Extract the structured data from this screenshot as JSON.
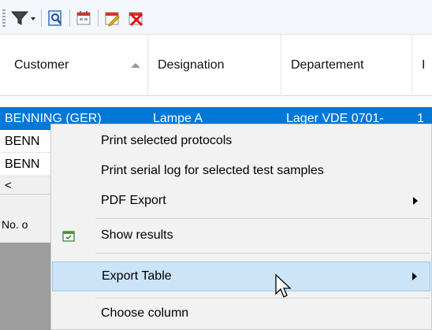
{
  "toolbar": {
    "buttons": [
      {
        "icon": "filter-dropdown-icon"
      },
      {
        "icon": "search-document-icon"
      },
      {
        "icon": "calendar-icon"
      },
      {
        "icon": "edit-calendar-icon"
      },
      {
        "icon": "delete-calendar-icon"
      }
    ]
  },
  "grid": {
    "columns": [
      {
        "label": "Customer",
        "sort": "ascending"
      },
      {
        "label": "Designation"
      },
      {
        "label": "Departement"
      },
      {
        "label": "I"
      }
    ],
    "rows": [
      {
        "customer": "BENNING (GER)",
        "designation": "Lampe A",
        "departement": "Lager VDE 0701-",
        "extra": "1",
        "selected": true
      },
      {
        "customer": "BENN",
        "selected": false
      },
      {
        "customer": "BENN",
        "selected": false
      }
    ],
    "footer_label": "No. o",
    "scroll_left_glyph": "<"
  },
  "context_menu": {
    "items": [
      {
        "label": "Print selected protocols"
      },
      {
        "label": "Print serial log for selected test samples"
      },
      {
        "label": "PDF Export",
        "submenu": true
      },
      {
        "label": "Show results",
        "icon": "calendar-check-icon"
      },
      {
        "label": "Export Table",
        "submenu": true,
        "highlighted": true
      },
      {
        "label": "Choose column"
      }
    ]
  },
  "colors": {
    "selection": "#0078d7",
    "menu_highlight": "#cce4f7",
    "menu_background": "#f2f2f2"
  }
}
